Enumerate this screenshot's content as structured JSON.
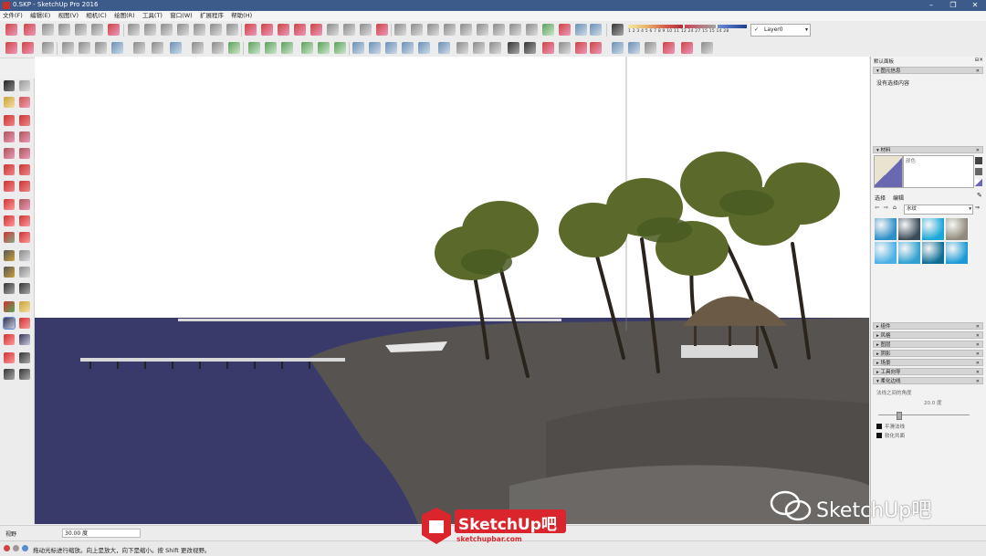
{
  "window": {
    "title": "0.SKP - SketchUp Pro 2016",
    "controls": [
      "–",
      "❐",
      "✕"
    ]
  },
  "menu": [
    "文件(F)",
    "编辑(E)",
    "视图(V)",
    "相机(C)",
    "绘图(R)",
    "工具(T)",
    "窗口(W)",
    "扩展程序",
    "帮助(H)"
  ],
  "layer_selector": {
    "value": "Layer0",
    "checked": "✓"
  },
  "color_scale": {
    "ticks": "1 2 3 4 5 6 7 8 9 10 11 12      24 27          15 15          14 28"
  },
  "right_panel": {
    "title": "默认面板",
    "sections": {
      "entity_info": {
        "title": "图元信息",
        "content": "没有选择内容"
      },
      "materials": {
        "title": "材料",
        "material_name": "颜色",
        "tab_select": "选择",
        "tab_edit": "编辑",
        "category": "水纹",
        "swatch_colors": [
          "#2c8fc8",
          "#3a4c5a",
          "#19a6d8",
          "#8f8a7a",
          "#4ab0e6",
          "#2fa0d0",
          "#0d6d95",
          "#1b9ad6"
        ]
      },
      "collapsed": [
        "组件",
        "风格",
        "图层",
        "阴影",
        "场景",
        "工具向导"
      ],
      "soften_edges": {
        "title": "柔化边线",
        "label": "法线之间的角度",
        "angle_value": "20.0 度",
        "slider_value": 0.22,
        "option_smooth": "平滑法线",
        "option_soften": "软化共面"
      }
    }
  },
  "measurement": {
    "label": "视野",
    "value": "30.00 度"
  },
  "status": {
    "text": "拖动光标进行缩放。向上是放大，向下是缩小。按 Shift 更改视野。"
  },
  "watermark": {
    "logo_text": "SketchUp吧",
    "logo_url": "sketchupbar.com",
    "social_text": "SketchUp吧"
  },
  "scene_colors": {
    "sky": "#ffffff",
    "sea": "#3a3a6a",
    "sand": "#565350",
    "palm": "#5b6a2a",
    "trunk": "#2a241c"
  }
}
